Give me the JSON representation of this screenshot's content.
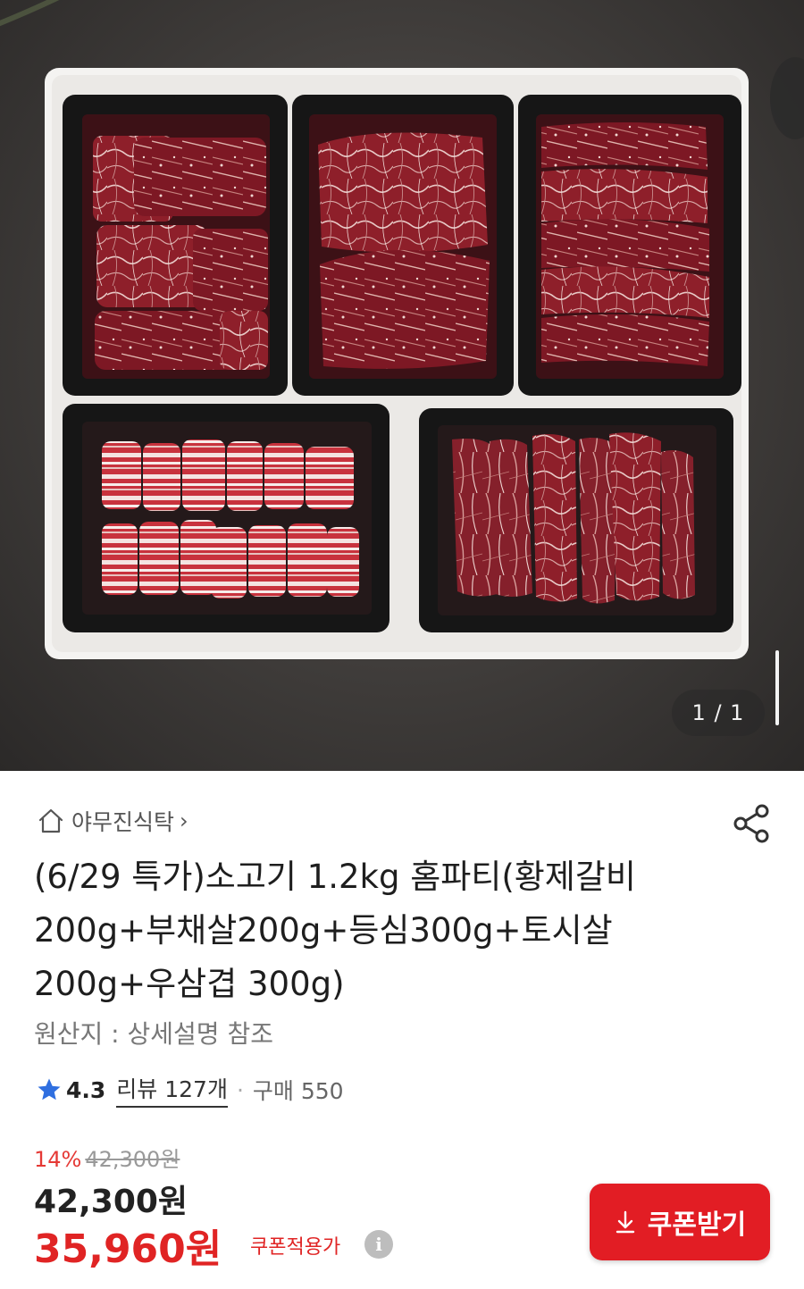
{
  "gallery": {
    "counter": "1 / 1",
    "image_alt": "소고기 1.2kg 홈파티 세트 (5칸 트레이)"
  },
  "store": {
    "name": "야무진식탁",
    "home_icon": "home-icon",
    "share_icon": "share-icon"
  },
  "product": {
    "title": "(6/29 특가)소고기 1.2kg 홈파티(황제갈비200g+부채살200g+등심300g+토시살200g+우삼겹 300g)",
    "origin": "원산지 : 상세설명 참조"
  },
  "rating": {
    "score": "4.3",
    "reviews": "리뷰 127개",
    "separator": "·",
    "purchases": "구매 550",
    "star_color": "#2f6fe0"
  },
  "pricing": {
    "discount": "14%",
    "original": "42,300원",
    "price": "42,300원",
    "coupon_price": "35,960원",
    "coupon_label": "쿠폰적용가",
    "info_glyph": "i",
    "accent_color": "#e02424"
  },
  "actions": {
    "coupon_button": "쿠폰받기",
    "download_icon": "download-icon"
  }
}
